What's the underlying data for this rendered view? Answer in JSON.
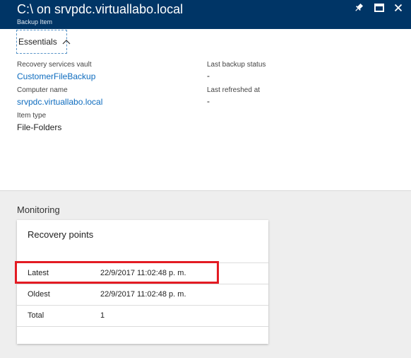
{
  "window": {
    "title": "C:\\ on srvpdc.virtuallabo.local",
    "subtitle": "Backup Item"
  },
  "icons": {
    "pin": "pin-icon",
    "maximize": "maximize-icon",
    "close": "close-icon",
    "essentials_chevron": "chevron-up-icon"
  },
  "colors": {
    "header_bg": "#003566",
    "link": "#0e6cbf",
    "highlight": "#e31b23",
    "monitoring_bg": "#eeeeee"
  },
  "essentials": {
    "label": "Essentials",
    "fields": {
      "vault_label": "Recovery services vault",
      "vault_value": "CustomerFileBackup",
      "computer_label": "Computer name",
      "computer_value": "srvpdc.virtuallabo.local",
      "itemtype_label": "Item type",
      "itemtype_value": "File-Folders",
      "lastbackup_label": "Last backup status",
      "lastbackup_value": "-",
      "lastrefreshed_label": "Last refreshed at",
      "lastrefreshed_value": "-"
    }
  },
  "monitoring": {
    "title": "Monitoring",
    "card_title": "Recovery points",
    "rows": [
      {
        "label": "Latest",
        "value": "22/9/2017 11:02:48 p. m."
      },
      {
        "label": "Oldest",
        "value": "22/9/2017 11:02:48 p. m."
      },
      {
        "label": "Total",
        "value": "1"
      }
    ]
  }
}
